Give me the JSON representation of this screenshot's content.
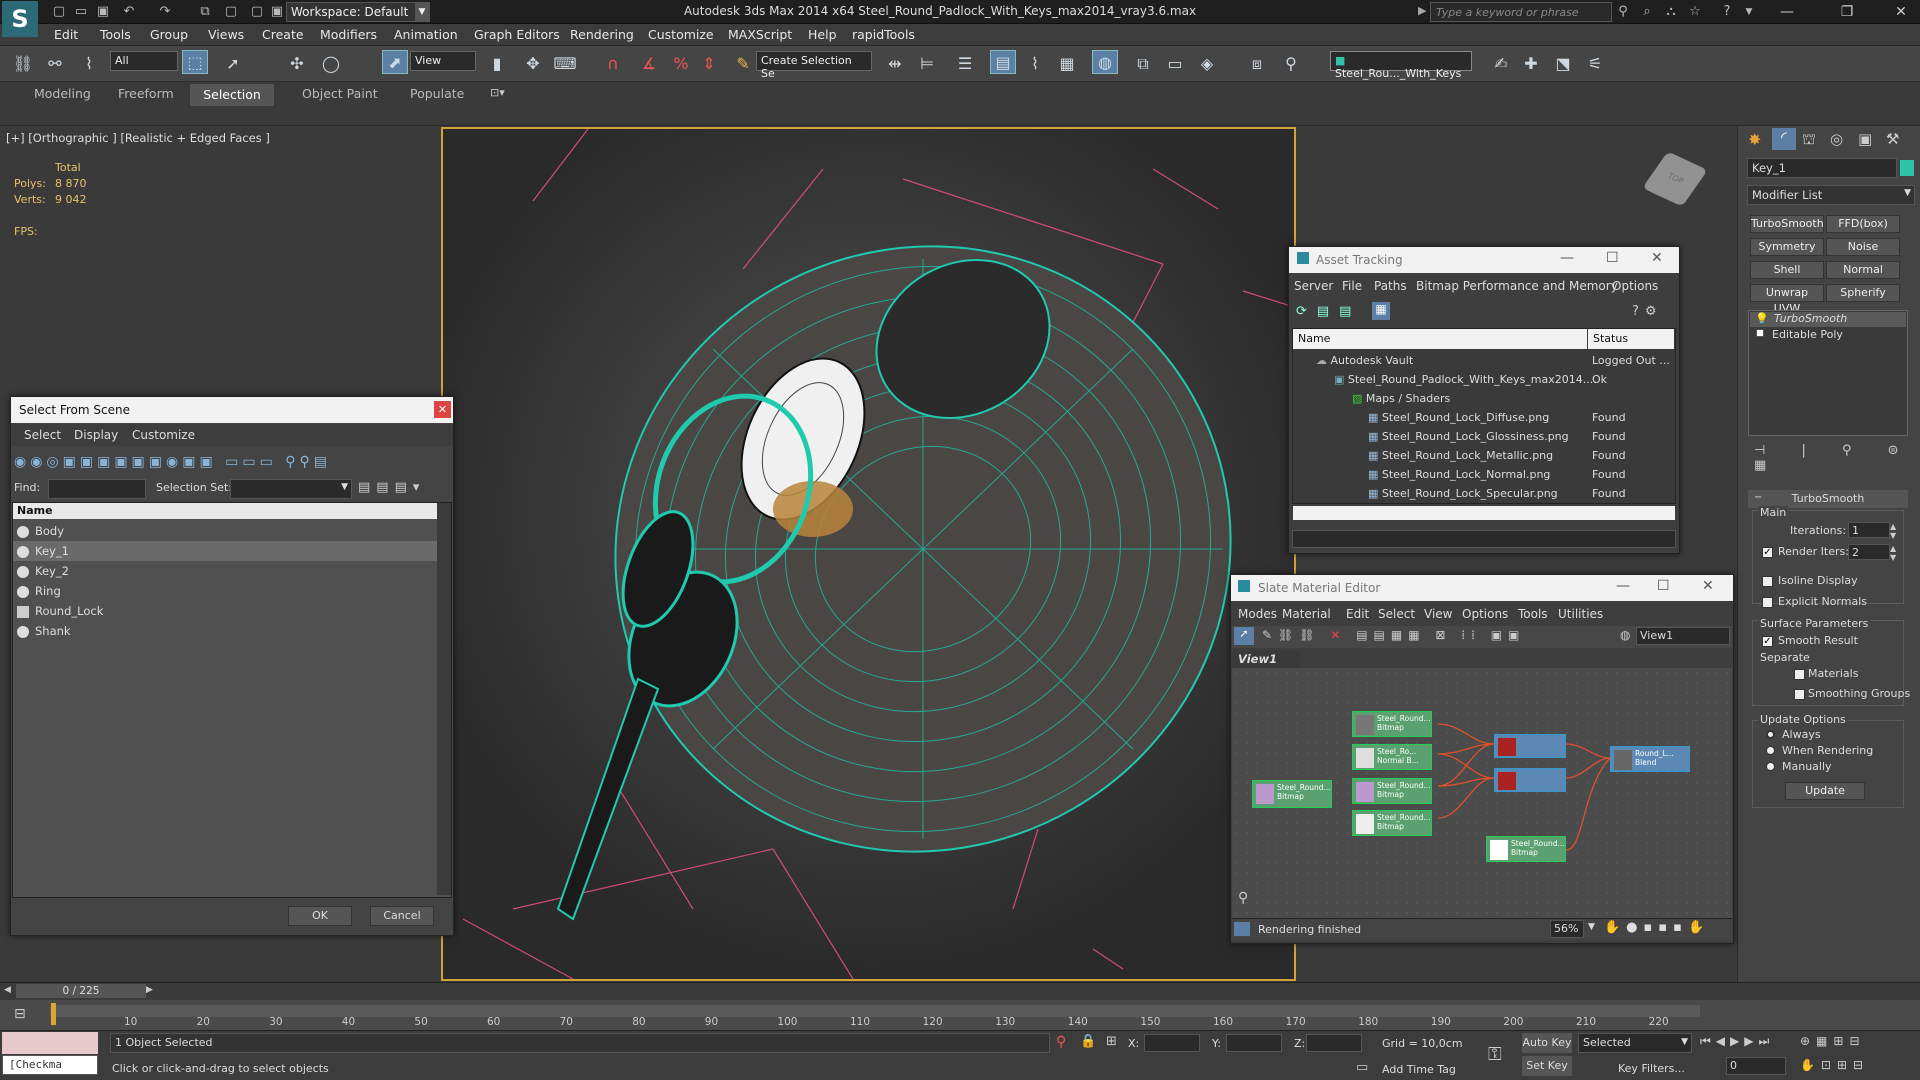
{
  "title": {
    "workspace": "Workspace: Default",
    "app_title": "Autodesk 3ds Max  2014 x64      Steel_Round_Padlock_With_Keys_max2014_vray3.6.max",
    "search_placeholder": "Type a keyword or phrase"
  },
  "menu": [
    "Edit",
    "Tools",
    "Group",
    "Views",
    "Create",
    "Modifiers",
    "Animation",
    "Graph Editors",
    "Rendering",
    "Customize",
    "MAXScript",
    "Help",
    "rapidTools"
  ],
  "toolbar": {
    "selection_filter": "All",
    "ref_coord": "View",
    "named_selection_set": "Create Selection Se",
    "object_field": "Steel_Rou..._With_Keys"
  },
  "ribbon": {
    "tabs": [
      "Modeling",
      "Freeform",
      "Selection",
      "Object Paint",
      "Populate"
    ]
  },
  "viewport": {
    "label": "[+] [Orthographic ] [Realistic + Edged Faces ]",
    "stats": {
      "total_label": "Total",
      "polys_label": "Polys:",
      "polys_value": "8 870",
      "verts_label": "Verts:",
      "verts_value": "9 042",
      "fps_label": "FPS:"
    }
  },
  "command_panel": {
    "object_name": "Key_1",
    "modifier_list_label": "Modifier List",
    "modifier_buttons": [
      "TurboSmooth",
      "FFD(box)",
      "Symmetry",
      "Noise",
      "Shell",
      "Normal",
      "Unwrap UVW",
      "Spherify"
    ],
    "stack": [
      "TurboSmooth",
      "Editable Poly"
    ],
    "rollout_title": "TurboSmooth",
    "main_label": "Main",
    "iterations_label": "Iterations:",
    "iterations_value": "1",
    "render_iters_label": "Render Iters:",
    "render_iters_value": "2",
    "isoline_label": "Isoline Display",
    "explicit_normals_label": "Explicit Normals",
    "surface_params_label": "Surface Parameters",
    "smooth_result_label": "Smooth Result",
    "separate_label": "Separate",
    "materials_label": "Materials",
    "smoothing_groups_label": "Smoothing Groups",
    "update_options_label": "Update Options",
    "always_label": "Always",
    "when_rendering_label": "When Rendering",
    "manually_label": "Manually",
    "update_button": "Update"
  },
  "select_from_scene": {
    "title": "Select From Scene",
    "menu": [
      "Select",
      "Display",
      "Customize"
    ],
    "find_label": "Find:",
    "selection_set_label": "Selection Set:",
    "column_name": "Name",
    "items": [
      "Body",
      "Key_1",
      "Key_2",
      "Ring",
      "Round_Lock",
      "Shank"
    ],
    "ok": "OK",
    "cancel": "Cancel"
  },
  "asset_tracking": {
    "title": "Asset Tracking",
    "menu": [
      "Server",
      "File",
      "Paths",
      "Bitmap Performance and Memory",
      "Options"
    ],
    "col_name": "Name",
    "col_status": "Status",
    "rows": [
      {
        "name": "Autodesk Vault",
        "status": "Logged Out ..."
      },
      {
        "name": "Steel_Round_Padlock_With_Keys_max2014....",
        "status": "Ok"
      },
      {
        "name": "Maps / Shaders",
        "status": ""
      },
      {
        "name": "Steel_Round_Lock_Diffuse.png",
        "status": "Found"
      },
      {
        "name": "Steel_Round_Lock_Glossiness.png",
        "status": "Found"
      },
      {
        "name": "Steel_Round_Lock_Metallic.png",
        "status": "Found"
      },
      {
        "name": "Steel_Round_Lock_Normal.png",
        "status": "Found"
      },
      {
        "name": "Steel_Round_Lock_Specular.png",
        "status": "Found"
      }
    ]
  },
  "slate": {
    "title": "Slate Material Editor",
    "menu": [
      "Modes",
      "Material",
      "Edit",
      "Select",
      "View",
      "Options",
      "Tools",
      "Utilities"
    ],
    "view_field": "View1",
    "tab": "View1",
    "status": "Rendering finished",
    "zoom": "56%",
    "nodes": [
      {
        "title": "Steel_Round...",
        "sub": "Bitmap"
      },
      {
        "title": "Steel_Round...",
        "sub": "Bitmap"
      },
      {
        "title": "Steel_Ro...",
        "sub": "Normal B..."
      },
      {
        "title": "Steel_Round...",
        "sub": "Bitmap"
      },
      {
        "title": "Steel_Round...",
        "sub": "Bitmap"
      },
      {
        "title": "Steel_Round...",
        "sub": "Bitmap"
      },
      {
        "title": "Round_L...",
        "sub": "Blend"
      }
    ]
  },
  "time": {
    "frame": "0 / 225",
    "ticks": [
      "10",
      "20",
      "30",
      "40",
      "50",
      "60",
      "70",
      "80",
      "90",
      "100",
      "110",
      "120",
      "130",
      "140",
      "150",
      "160",
      "170",
      "180",
      "190",
      "200",
      "210",
      "220"
    ]
  },
  "status": {
    "script_field": "[Checkma",
    "selection_msg": "1 Object Selected",
    "prompt": "Click or click-and-drag to select objects",
    "x_label": "X:",
    "y_label": "Y:",
    "z_label": "Z:",
    "grid": "Grid = 10,0cm",
    "add_time_tag": "Add Time Tag",
    "auto_key": "Auto Key",
    "set_key": "Set Key",
    "selected": "Selected",
    "key_filters": "Key Filters...",
    "frame_value": "0"
  }
}
